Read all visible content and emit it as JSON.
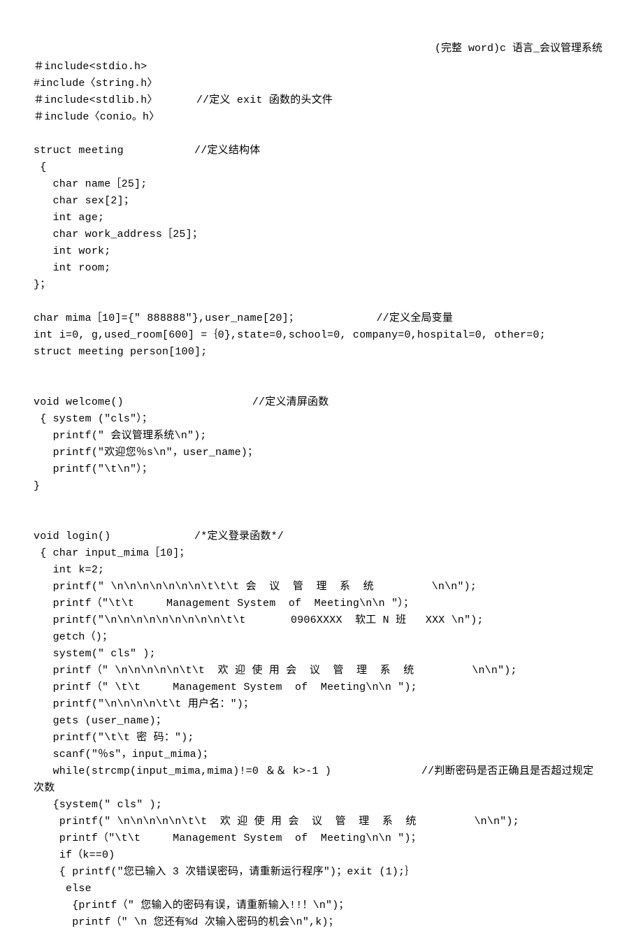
{
  "header": "(完整 word)c 语言_会议管理系统",
  "lines": [
    "＃include<stdio.h>",
    "#include〈string.h〉",
    "＃include<stdlib.h〉      //定义 exit 函数的头文件",
    "＃include〈conio。h〉",
    "",
    "struct meeting           //定义结构体",
    " {",
    "   char name［25];",
    "   char sex[2]；",
    "   int age;",
    "   char work_address［25]；",
    "   int work;",
    "   int room;",
    "}；",
    "",
    "char mima［10]={\" 888888\"},user_name[20]；            //定义全局变量",
    "int i=0, g,used_room[600] =｛0},state=0,school=0, company=0,hospital=0, other=0;",
    "struct meeting person[100];",
    "",
    "",
    "void welcome()                    //定义清屏函数",
    " { system (\"cls\"）；",
    "   printf(\" 会议管理系统\\n\");",
    "   printf(\"欢迎您％s\\n\"，user_name)；",
    "   printf(\"\\t\\n\"）；",
    "}",
    "",
    "",
    "void login()             /*定义登录函数*/",
    " { char input_mima［10]；",
    "   int k=2;",
    "   printf(\" \\n\\n\\n\\n\\n\\n\\n\\t\\t\\t 会  议  管  理  系  统         \\n\\n\");",
    "   printf（\"\\t\\t     Management System  of  Meeting\\n\\n \"）；",
    "   printf(\"\\n\\n\\n\\n\\n\\n\\n\\n\\n\\t\\t       0906XXXX  软工 N 班   XXX \\n\");",
    "   getch（)；",
    "   system(\" cls\" );",
    "   printf（\" \\n\\n\\n\\n\\n\\t\\t  欢 迎 使 用 会  议  管  理  系  统         \\n\\n\");",
    "   printf（\" \\t\\t     Management System  of  Meeting\\n\\n \");",
    "   printf(\"\\n\\n\\n\\n\\t\\t 用户名：\")；",
    "   gets (user_name)；",
    "   printf(\"\\t\\t 密 码：\");",
    "   scanf(\"％s\"，input_mima)；",
    "   while(strcmp(input_mima,mima)!=0 ＆＆ k>-1 )              //判断密码是否正确且是否超过规定",
    "次数",
    "   {system(\" cls\" );",
    "    printf(\" \\n\\n\\n\\n\\n\\t\\t  欢 迎 使 用 会  议  管  理  系  统         \\n\\n\");",
    "    printf（\"\\t\\t     Management System  of  Meeting\\n\\n \")；",
    "    if（k==0)",
    "    { printf(\"您已输入 3 次错误密码，请重新运行程序\")；exit (1);｝",
    "     else",
    "      {printf（\" 您输入的密码有误，请重新输入!!！\\n\")；",
    "      printf（\" \\n 您还有%d 次输入密码的机会\\n\",k)；"
  ]
}
